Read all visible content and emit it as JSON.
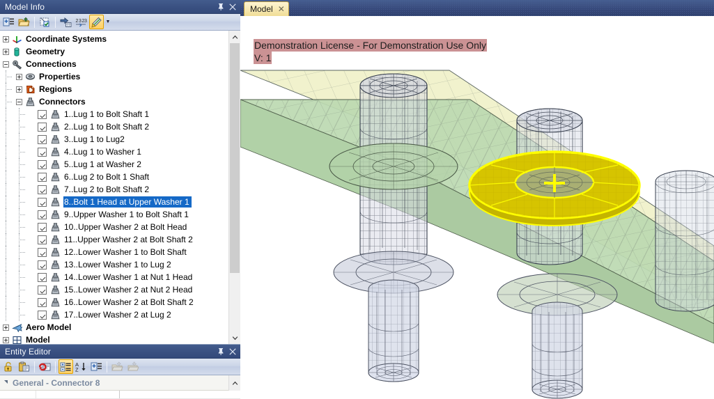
{
  "model_info_panel": {
    "title": "Model Info",
    "pin_icon": "pin-icon",
    "close_icon": "close-icon",
    "toolbar": [
      {
        "name": "add-entity-icon",
        "label": "Add Entity"
      },
      {
        "name": "open-folder-icon",
        "label": "Open"
      },
      {
        "name": "select-check-icon",
        "label": "Select"
      },
      {
        "name": "move-to-icon",
        "label": "Move To"
      },
      {
        "name": "renumber-icon",
        "label": "Renumber"
      },
      {
        "name": "highlight-pen-icon",
        "label": "Highlight"
      },
      {
        "name": "dropdown-arrow-icon",
        "label": "More"
      }
    ]
  },
  "tree": {
    "nodes": [
      {
        "label": "Coordinate Systems",
        "icon": "axes-icon",
        "level": 0,
        "expander": "plus",
        "bold": true,
        "checkbox": false
      },
      {
        "label": "Geometry",
        "icon": "cylinder-icon",
        "level": 0,
        "expander": "plus",
        "bold": true,
        "checkbox": false
      },
      {
        "label": "Connections",
        "icon": "wrench-icon",
        "level": 0,
        "expander": "minus",
        "bold": true,
        "checkbox": false
      },
      {
        "label": "Properties",
        "icon": "bolt-head-icon",
        "level": 1,
        "expander": "plus",
        "bold": true,
        "checkbox": false
      },
      {
        "label": "Regions",
        "icon": "region-icon",
        "level": 1,
        "expander": "plus",
        "bold": true,
        "checkbox": false
      },
      {
        "label": "Connectors",
        "icon": "connector-icon",
        "level": 1,
        "expander": "minus",
        "bold": true,
        "checkbox": false
      },
      {
        "label": "1..Lug 1 to Bolt Shaft 1",
        "icon": "connector-icon",
        "level": 2,
        "expander": "none",
        "bold": false,
        "checkbox": true
      },
      {
        "label": "2..Lug 1 to Bolt Shaft 2",
        "icon": "connector-icon",
        "level": 2,
        "expander": "none",
        "bold": false,
        "checkbox": true
      },
      {
        "label": "3..Lug 1 to Lug2",
        "icon": "connector-icon",
        "level": 2,
        "expander": "none",
        "bold": false,
        "checkbox": true
      },
      {
        "label": "4..Lug 1 to Washer 1",
        "icon": "connector-icon",
        "level": 2,
        "expander": "none",
        "bold": false,
        "checkbox": true
      },
      {
        "label": "5..Lug 1 at Washer 2",
        "icon": "connector-icon",
        "level": 2,
        "expander": "none",
        "bold": false,
        "checkbox": true
      },
      {
        "label": "6..Lug 2 to Bolt 1 Shaft",
        "icon": "connector-icon",
        "level": 2,
        "expander": "none",
        "bold": false,
        "checkbox": true
      },
      {
        "label": "7..Lug 2 to Bolt Shaft 2",
        "icon": "connector-icon",
        "level": 2,
        "expander": "none",
        "bold": false,
        "checkbox": true
      },
      {
        "label": "8..Bolt 1 Head at Upper Washer 1",
        "icon": "connector-icon",
        "level": 2,
        "expander": "none",
        "bold": false,
        "checkbox": true,
        "selected": true
      },
      {
        "label": "9..Upper Washer 1 to Bolt Shaft 1",
        "icon": "connector-icon",
        "level": 2,
        "expander": "none",
        "bold": false,
        "checkbox": true
      },
      {
        "label": "10..Upper Washer 2 at Bolt Head",
        "icon": "connector-icon",
        "level": 2,
        "expander": "none",
        "bold": false,
        "checkbox": true
      },
      {
        "label": "11..Upper Washer 2 at Bolt Shaft 2",
        "icon": "connector-icon",
        "level": 2,
        "expander": "none",
        "bold": false,
        "checkbox": true
      },
      {
        "label": "12..Lower Washer 1 to Bolt Shaft",
        "icon": "connector-icon",
        "level": 2,
        "expander": "none",
        "bold": false,
        "checkbox": true
      },
      {
        "label": "13..Lower Washer 1 to Lug 2",
        "icon": "connector-icon",
        "level": 2,
        "expander": "none",
        "bold": false,
        "checkbox": true
      },
      {
        "label": "14..Lower Washer 1 at Nut 1 Head",
        "icon": "connector-icon",
        "level": 2,
        "expander": "none",
        "bold": false,
        "checkbox": true
      },
      {
        "label": "15..Lower Washer 2 at Nut 2 Head",
        "icon": "connector-icon",
        "level": 2,
        "expander": "none",
        "bold": false,
        "checkbox": true
      },
      {
        "label": "16..Lower Washer 2 at Bolt Shaft 2",
        "icon": "connector-icon",
        "level": 2,
        "expander": "none",
        "bold": false,
        "checkbox": true
      },
      {
        "label": "17..Lower Washer 2 at Lug 2",
        "icon": "connector-icon",
        "level": 2,
        "expander": "none",
        "bold": false,
        "checkbox": true
      },
      {
        "label": "Aero Model",
        "icon": "airplane-icon",
        "level": 0,
        "expander": "plus",
        "bold": true,
        "checkbox": false
      },
      {
        "label": "Model",
        "icon": "grid-icon",
        "level": 0,
        "expander": "plus",
        "bold": true,
        "checkbox": false
      }
    ],
    "scroll_up_icon": "chevron-up-icon",
    "scroll_down_icon": "chevron-down-icon"
  },
  "entity_editor": {
    "title": "Entity Editor",
    "pin_icon": "pin-icon",
    "close_icon": "close-icon",
    "toolbar": [
      {
        "name": "lock-icon",
        "label": "Lock"
      },
      {
        "name": "paste-icon",
        "label": "Paste"
      },
      {
        "name": "refresh-icon",
        "label": "Refresh"
      },
      {
        "name": "categorized-view-icon",
        "label": "Categorized"
      },
      {
        "name": "sort-alpha-icon",
        "label": "Sort A-Z"
      },
      {
        "name": "expand-all-icon",
        "label": "Expand All"
      },
      {
        "name": "import-icon",
        "label": "Import"
      },
      {
        "name": "export-icon",
        "label": "Export"
      }
    ],
    "group_header": "General - Connector 8",
    "collapse_icon": "triangle-collapse-icon",
    "scroll_up_icon": "chevron-up-icon"
  },
  "workspace": {
    "tabs": [
      {
        "label": "Model",
        "close_icon": "close-icon",
        "active": true
      }
    ]
  },
  "viewport": {
    "license_line1": "Demonstration License - For Demonstration Use Only",
    "license_line2": "V: 1",
    "license_bg_color": "#cb9294",
    "background_color": "#ffffff",
    "highlight_color": "#ffff00",
    "plate_upper_color": "#f2f2cf",
    "plate_lower_color": "#b9d9b3",
    "bolt_mesh_color": "#d6d9e4",
    "mesh_line_color": "#3a4050"
  }
}
